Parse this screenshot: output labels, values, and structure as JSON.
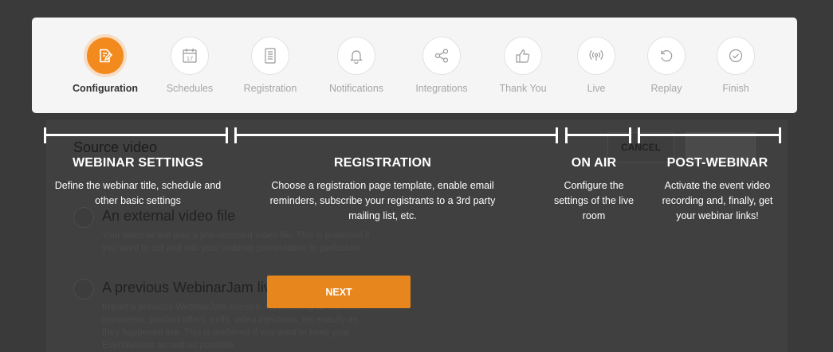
{
  "stepper": {
    "steps": [
      {
        "label": "Configuration",
        "icon": "edit-document-icon",
        "active": true
      },
      {
        "label": "Schedules",
        "icon": "calendar-icon",
        "active": false,
        "calendar_day": "17"
      },
      {
        "label": "Registration",
        "icon": "form-icon",
        "active": false
      },
      {
        "label": "Notifications",
        "icon": "bell-icon",
        "active": false
      },
      {
        "label": "Integrations",
        "icon": "share-icon",
        "active": false
      },
      {
        "label": "Thank You",
        "icon": "thumbs-up-icon",
        "active": false
      },
      {
        "label": "Live",
        "icon": "broadcast-icon",
        "active": false
      },
      {
        "label": "Replay",
        "icon": "replay-icon",
        "active": false
      },
      {
        "label": "Finish",
        "icon": "check-circle-icon",
        "active": false
      }
    ]
  },
  "phases": {
    "webinar_settings": {
      "title": "WEBINAR SETTINGS",
      "line1": "Define the webinar title, schedule and",
      "line2": "other basic settings"
    },
    "registration": {
      "title": "REGISTRATION",
      "line1": "Choose a registration page template, enable email",
      "line2": "reminders, subscribe your registrants to a 3rd party",
      "line3": "mailing list, etc."
    },
    "on_air": {
      "title": "ON AIR",
      "line1": "Configure the",
      "line2": "settings of the live",
      "line3": "room"
    },
    "post_webinar": {
      "title": "POST-WEBINAR",
      "line1": "Activate the event video",
      "line2": "recording and, finally, get",
      "line3": "your webinar links!"
    }
  },
  "background": {
    "section_title": "Source video",
    "cancel_label": "CANCEL",
    "option1": {
      "title": "An external video file",
      "desc_line1": "Your webinar will play a pre-recorded video file. This is preferred if",
      "desc_line2": "you want to cut and edit your webinar presentation to perfection."
    },
    "option2": {
      "title": "A previous WebinarJam live",
      "desc_line1": "Import a previous WebinarJam session, reproducing all the chat",
      "desc_line2": "comments, product offers, polls, video injections, etc exactly as",
      "desc_line3": "they happened live. This is preferred if you want to keep your",
      "desc_line4": "EverWebinar as real as possible."
    }
  },
  "next_button": {
    "label": "NEXT"
  },
  "colors": {
    "accent": "#f28a1e",
    "overlay": "#3a3a3a",
    "card": "#f5f5f5"
  }
}
